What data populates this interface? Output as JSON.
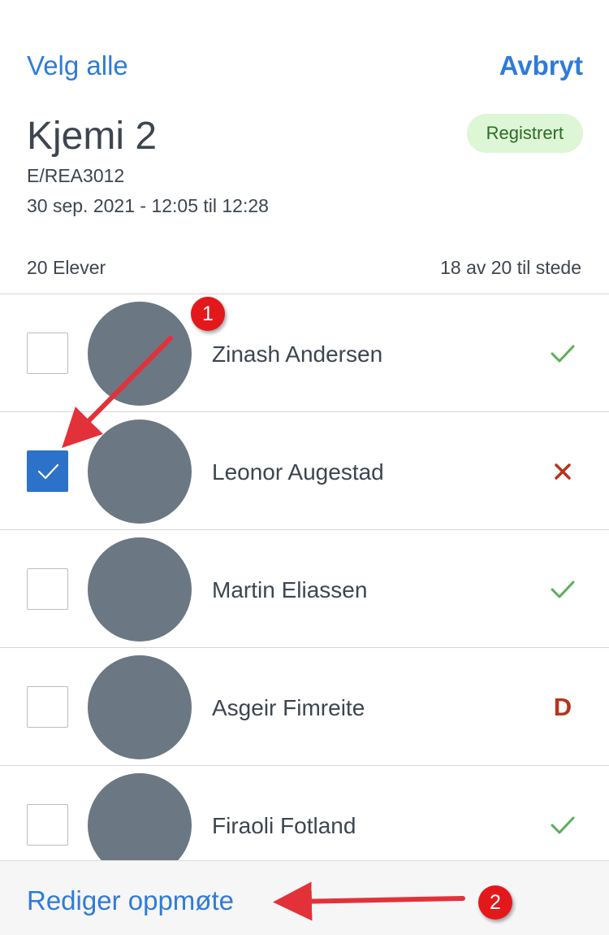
{
  "header": {
    "select_all": "Velg alle",
    "cancel": "Avbryt"
  },
  "lesson": {
    "title": "Kjemi 2",
    "status_badge": "Registrert",
    "code": "E/REA3012",
    "time": "30 sep. 2021 - 12:05 til 12:28"
  },
  "summary": {
    "students": "20 Elever",
    "present": "18 av 20 til stede"
  },
  "students": [
    {
      "name": "Zinash Andersen",
      "checked": false,
      "status": "present",
      "status_icon": "check-icon"
    },
    {
      "name": "Leonor Augestad",
      "checked": true,
      "status": "absent",
      "status_icon": "cross-icon"
    },
    {
      "name": "Martin Eliassen",
      "checked": false,
      "status": "present",
      "status_icon": "check-icon"
    },
    {
      "name": "Asgeir Fimreite",
      "checked": false,
      "status": "D",
      "status_icon": "letter-d"
    },
    {
      "name": "Firaoli Fotland",
      "checked": false,
      "status": "present",
      "status_icon": "check-icon"
    }
  ],
  "footer": {
    "edit_attendance": "Rediger oppmøte"
  },
  "annotations": {
    "marker1": "1",
    "marker2": "2"
  },
  "colors": {
    "accent": "#2f7bd9",
    "checkbox_checked": "#2d72c9",
    "present": "#5aaf5a",
    "absent": "#b6341c",
    "badge_bg": "#dcf6d6",
    "badge_text": "#2e6b26",
    "avatar": "#6b7783",
    "annotation": "#e3181b"
  }
}
